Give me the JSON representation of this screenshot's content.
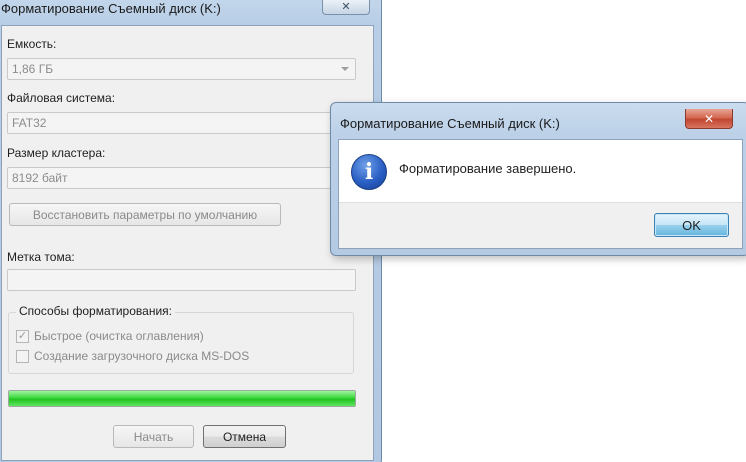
{
  "format_window": {
    "title": "Форматирование Съемный диск (K:)",
    "close_glyph": "✕",
    "capacity": {
      "label": "Емкость:",
      "value": "1,86 ГБ"
    },
    "filesystem": {
      "label": "Файловая система:",
      "value": "FAT32"
    },
    "cluster": {
      "label": "Размер кластера:",
      "value": "8192 байт"
    },
    "restore_button": "Восстановить параметры по умолчанию",
    "volume_label": {
      "label": "Метка тома:",
      "value": ""
    },
    "format_options": {
      "title": "Способы форматирования:",
      "quick": {
        "label": "Быстрое (очистка оглавления)",
        "checked": true
      },
      "msdos": {
        "label": "Создание загрузочного диска MS-DOS",
        "checked": false
      }
    },
    "progress": {
      "percent": 100,
      "color": "#22c322"
    },
    "start_button": "Начать",
    "cancel_button": "Отмена"
  },
  "message_box": {
    "title": "Форматирование Съемный диск (K:)",
    "close_glyph": "✕",
    "icon": "info-icon",
    "icon_glyph": "i",
    "message": "Форматирование завершено.",
    "ok_button": "OK"
  }
}
